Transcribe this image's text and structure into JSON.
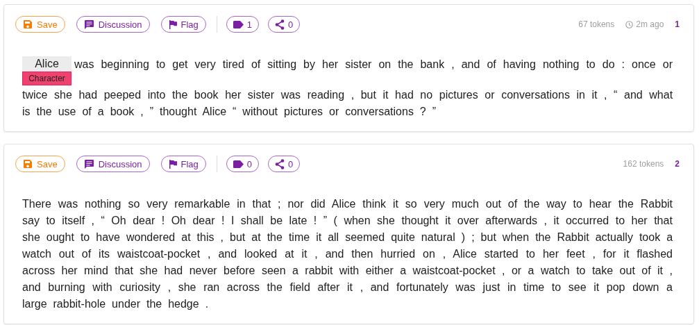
{
  "cards": [
    {
      "buttons": [
        {
          "kind": "save",
          "label": "Save"
        },
        {
          "kind": "discussion",
          "label": "Discussion"
        },
        {
          "kind": "flag",
          "label": "Flag"
        }
      ],
      "counters": [
        {
          "kind": "tag",
          "count": "1"
        },
        {
          "kind": "share",
          "count": "0"
        }
      ],
      "tokens": "67 tokens",
      "time": "2m ago",
      "index": "1",
      "segments": [
        {
          "kind": "entity",
          "text": "Alice",
          "label": "Character"
        },
        {
          "kind": "text",
          "text": "was beginning to get very tired of sitting by her sister on the bank , and of having nothing to do : once or twice she had peeped into the book her sister was reading , but it had no pictures or conversations in it , “ and what is the use of a book , ” thought Alice “ without pictures or conversations ? ”"
        }
      ]
    },
    {
      "buttons": [
        {
          "kind": "save",
          "label": "Save"
        },
        {
          "kind": "discussion",
          "label": "Discussion"
        },
        {
          "kind": "flag",
          "label": "Flag"
        }
      ],
      "counters": [
        {
          "kind": "tag",
          "count": "0"
        },
        {
          "kind": "share",
          "count": "0"
        }
      ],
      "tokens": "162 tokens",
      "index": "2",
      "segments": [
        {
          "kind": "text",
          "text": "There was nothing so very remarkable in that ; nor did Alice think it so very much out of the way to hear the Rabbit say to itself , “ Oh dear ! Oh dear ! I shall be late ! ” ( when she thought it over afterwards , it occurred to her that she ought to have wondered at this , but at the time it all seemed quite natural ) ; but when the Rabbit actually took a watch out of its waistcoat-pocket , and looked at it , and then hurried on , Alice started to her feet , for it flashed across her mind that she had never before seen a rabbit with either a waistcoat-pocket , or a watch to take out of it , and burning with curiosity , she ran across the field after it , and fortunately was just in time to see it pop down a large rabbit-hole under the hedge ."
        }
      ]
    }
  ]
}
